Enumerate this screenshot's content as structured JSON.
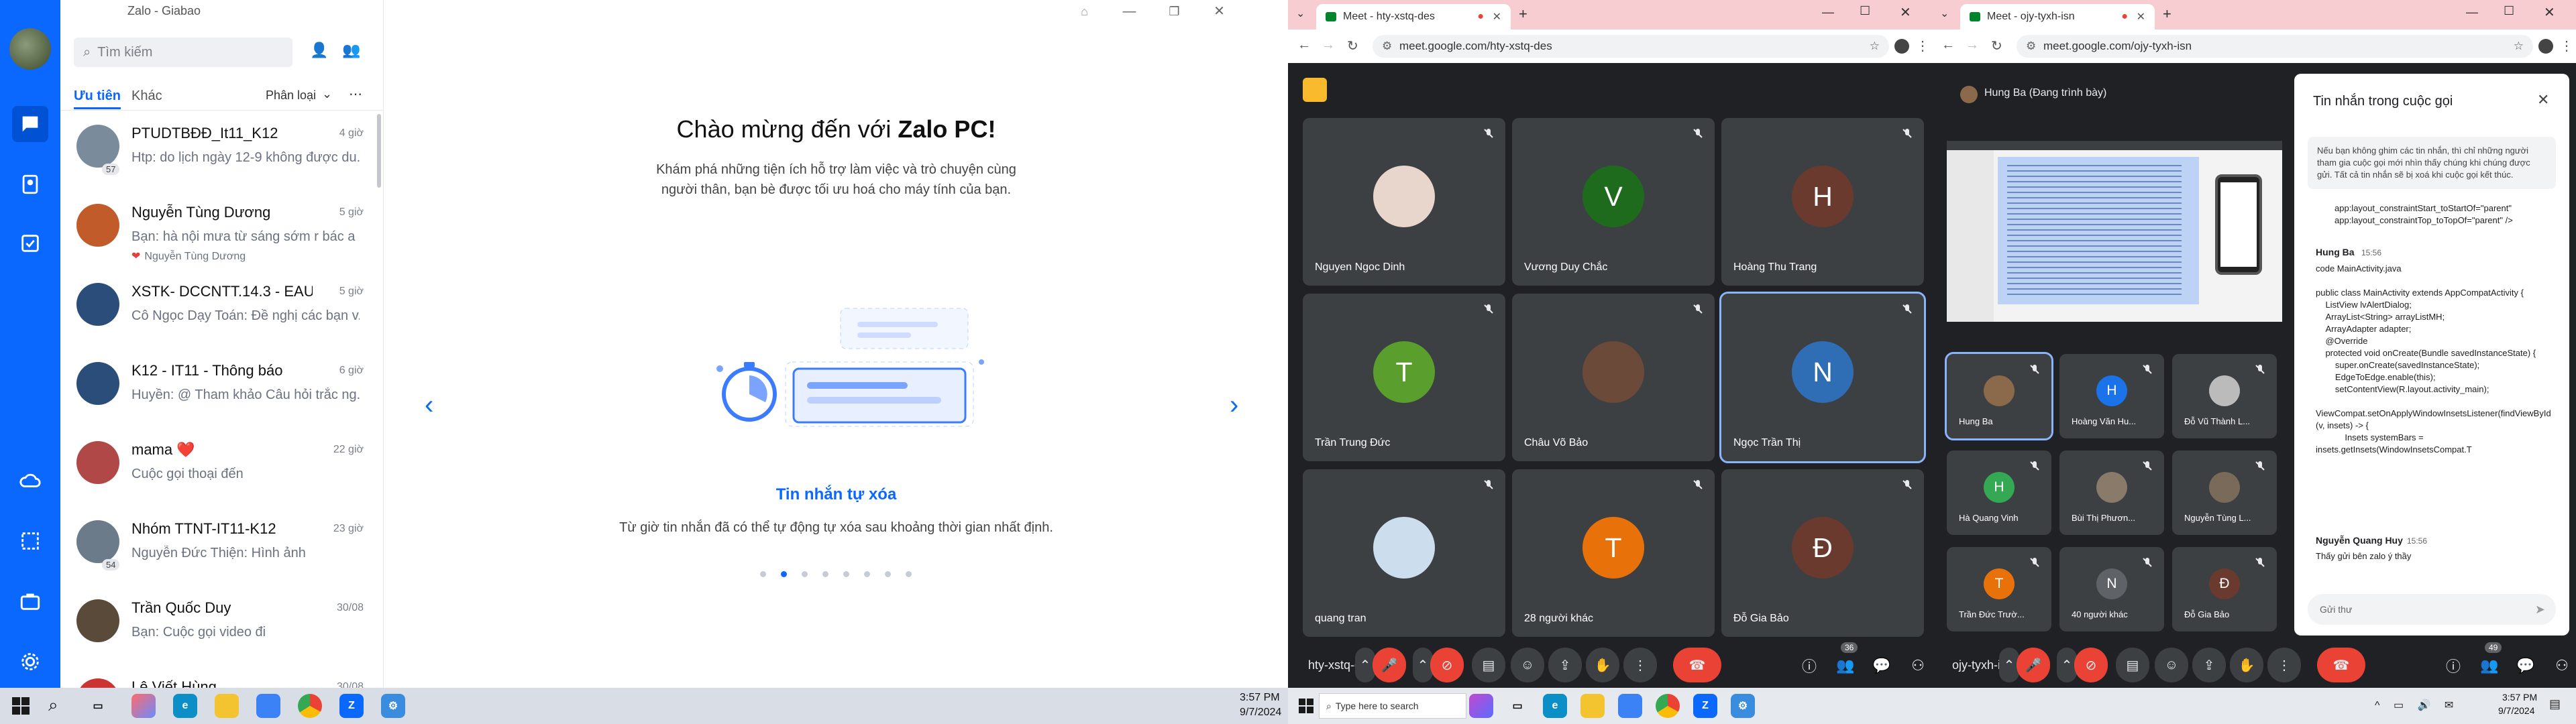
{
  "zalo": {
    "window_title": "Zalo - Giabao",
    "search_placeholder": "Tìm kiếm",
    "tabs": {
      "priority": "Ưu tiên",
      "other": "Khác",
      "classify": "Phân loại"
    },
    "chats": [
      {
        "name": "PTUDTBĐĐ_It11_K12",
        "time": "4 giờ",
        "msg": "Htp: do lịch ngày 12-9 không được du...",
        "badge": "57",
        "color": "#7a8b9c"
      },
      {
        "name": "Nguyễn Tùng Dương",
        "time": "5 giờ",
        "msg": "Bạn: hà nội mưa từ sáng sớm r bác a",
        "sub": "Nguyễn Tùng Dương",
        "color": "#c25b2a"
      },
      {
        "name": "XSTK- DCCNTT.14.3 - EAUT",
        "time": "5 giờ",
        "msg": "Cô Ngọc Dạy Toán: Đề nghị các bạn v...",
        "color": "#2a4d7a"
      },
      {
        "name": "K12 - IT11 - Thông báo",
        "time": "6 giờ",
        "msg": "Huyền: @ Tham khảo Câu hỏi trắc ng...",
        "color": "#2a4d7a"
      },
      {
        "name": "mama ❤️",
        "time": "22 giờ",
        "msg": "Cuộc gọi thoại đến",
        "color": "#b04848"
      },
      {
        "name": "Nhóm TTNT-IT11-K12",
        "time": "23 giờ",
        "msg": "Nguyễn Đức Thiện: Hình ảnh",
        "badge": "54",
        "color": "#6b7b8a"
      },
      {
        "name": "Trần Quốc Duy",
        "time": "30/08",
        "msg": "Bạn: Cuộc gọi video đi",
        "color": "#5a4a3a"
      },
      {
        "name": "Lê Viết Hùng",
        "time": "30/08",
        "msg": "CustomListView_BTVN",
        "color": "#c33"
      }
    ],
    "welcome": {
      "title_pre": "Chào mừng đến với ",
      "title_bold": "Zalo PC!",
      "desc1": "Khám phá những tiện ích hỗ trợ làm việc và trò chuyện cùng",
      "desc2": "người thân, bạn bè được tối ưu hoá cho máy tính của bạn.",
      "feature_title": "Tin nhắn tự xóa",
      "feature_desc": "Từ giờ tin nhắn đã có thể tự động tự xóa sau khoảng thời gian nhất định."
    }
  },
  "taskbar_left": {
    "time": "3:57 PM",
    "date": "9/7/2024"
  },
  "taskbar_right": {
    "search": "Type here to search",
    "time": "3:57 PM",
    "date": "9/7/2024"
  },
  "meet1": {
    "tab_title": "Meet - hty-xstq-des",
    "url": "meet.google.com/hty-xstq-des",
    "meeting_code": "hty-xstq-des",
    "participants_count": "36",
    "tiles": [
      {
        "name": "Nguyen Ngoc Dinh",
        "letter": "",
        "color": "#e8d5cc"
      },
      {
        "name": "Vương Duy Chắc",
        "letter": "V",
        "color": "#1e6b1e"
      },
      {
        "name": "Hoàng Thu Trang",
        "letter": "H",
        "color": "#6b3a2e"
      },
      {
        "name": "Trần Trung Đức",
        "letter": "T",
        "color": "#5a9e2e"
      },
      {
        "name": "Châu Võ Bảo",
        "letter": "",
        "color": "#6b4a3a"
      },
      {
        "name": "Ngọc Trần Thị",
        "letter": "N",
        "color": "#2f6db5"
      },
      {
        "name": "quang tran",
        "letter": "",
        "color": "#cde"
      },
      {
        "name": "28 người khác",
        "letter": "T",
        "color": "#e8710a"
      },
      {
        "name": "Đỗ Gia Bảo",
        "letter": "Đ",
        "color": "#6b3a2e"
      }
    ]
  },
  "meet2": {
    "tab_title": "Meet - ojy-tyxh-isn",
    "url": "meet.google.com/ojy-tyxh-isn",
    "meeting_code": "ojy-tyxh-isn",
    "presenter": "Hung Ba (Đang trình bày)",
    "participants_count": "49",
    "tiles": [
      {
        "name": "Hung Ba",
        "letter": "",
        "color": "#8a6a4a"
      },
      {
        "name": "Hoàng Văn Hu...",
        "letter": "H",
        "color": "#1a73e8"
      },
      {
        "name": "Đỗ Vũ Thành L...",
        "letter": "",
        "color": "#bbb"
      },
      {
        "name": "Hà Quang Vinh",
        "letter": "H",
        "color": "#34a853"
      },
      {
        "name": "Bùi Thị Phươn...",
        "letter": "",
        "color": "#8a7a6a"
      },
      {
        "name": "Nguyễn Tùng L...",
        "letter": "",
        "color": "#7a6a5a"
      },
      {
        "name": "Trần Đức Trườ...",
        "letter": "T",
        "color": "#e8710a"
      },
      {
        "name": "40 người khác",
        "letter": "N",
        "color": "#5f6368"
      },
      {
        "name": "Đỗ Gia Bảo",
        "letter": "Đ",
        "color": "#6b3a2e"
      }
    ],
    "chat": {
      "title": "Tin nhắn trong cuộc gọi",
      "notice": "Nếu bạn không ghim các tin nhắn, thì chỉ những người tham gia cuộc gọi mới nhìn thấy chúng khi chúng được gửi. Tất cả tin nhắn sẽ bị xoá khi cuộc gọi kết thúc.",
      "code_top": "app:layout_constraintStart_toStartOf=\"parent\"\napp:layout_constraintTop_toTopOf=\"parent\" />",
      "msg1_author": "Hung Ba",
      "msg1_time": "15:56",
      "msg1_body": "code MainActivity.java\n\npublic class MainActivity extends AppCompatActivity {\n    ListView lvAlertDialog;\n    ArrayList<String> arrayListMH;\n    ArrayAdapter adapter;\n    @Override\n    protected void onCreate(Bundle savedInstanceState) {\n        super.onCreate(savedInstanceState);\n        EdgeToEdge.enable(this);\n        setContentView(R.layout.activity_main);\n\nViewCompat.setOnApplyWindowInsetsListener(findViewById(R.id.main), (v, insets) -> {\n            Insets systemBars = insets.getInsets(WindowInsetsCompat.T",
      "msg2_author": "Nguyễn Quang Huy",
      "msg2_time": "15:56",
      "msg2_body": "Thấy gửi bên zalo ý thầy",
      "input_placeholder": "Gửi thư"
    }
  }
}
